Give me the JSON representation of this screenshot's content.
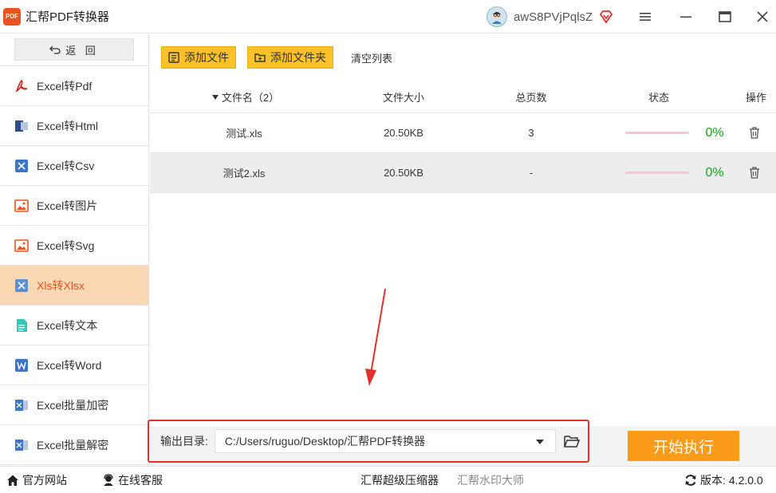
{
  "app": {
    "title": "汇帮PDF转换器",
    "logo_text": "PDF"
  },
  "user": {
    "name": "awS8PVjPqlsZ"
  },
  "sidebar": {
    "back_label": "返 回",
    "items": [
      {
        "label": "Excel转Pdf",
        "icon": "pdf-icon"
      },
      {
        "label": "Excel转Html",
        "icon": "html-icon"
      },
      {
        "label": "Excel转Csv",
        "icon": "excel-icon"
      },
      {
        "label": "Excel转图片",
        "icon": "image-icon"
      },
      {
        "label": "Excel转Svg",
        "icon": "image-icon"
      },
      {
        "label": "Xls转Xlsx",
        "icon": "excel-icon",
        "active": true
      },
      {
        "label": "Excel转文本",
        "icon": "text-file-icon"
      },
      {
        "label": "Excel转Word",
        "icon": "word-icon"
      },
      {
        "label": "Excel批量加密",
        "icon": "excel-lock-icon"
      },
      {
        "label": "Excel批量解密",
        "icon": "excel-unlock-icon"
      }
    ]
  },
  "toolbar": {
    "add_file": "添加文件",
    "add_folder": "添加文件夹",
    "clear_list": "清空列表"
  },
  "table": {
    "headers": {
      "name": "文件名（2）",
      "size": "文件大小",
      "pages": "总页数",
      "status": "状态",
      "action": "操作"
    },
    "rows": [
      {
        "name": "测试.xls",
        "size": "20.50KB",
        "pages": "3",
        "progress": "0%"
      },
      {
        "name": "测试2.xls",
        "size": "20.50KB",
        "pages": "-",
        "progress": "0%"
      }
    ]
  },
  "output": {
    "label": "输出目录:",
    "path": "C:/Users/ruguo/Desktop/汇帮PDF转换器"
  },
  "start_label": "开始执行",
  "footer": {
    "website": "官方网站",
    "support": "在线客服",
    "compressor": "汇帮超级压缩器",
    "watermark": "汇帮水印大师",
    "version_label": "版本:",
    "version": "4.2.0.0"
  },
  "colors": {
    "accent": "#fa9b1a",
    "button_yellow": "#fcc22a",
    "active_bg": "#fbd8b4",
    "active_text": "#e8531f",
    "annotation_red": "#e2302a",
    "progress_text": "#19a319"
  }
}
